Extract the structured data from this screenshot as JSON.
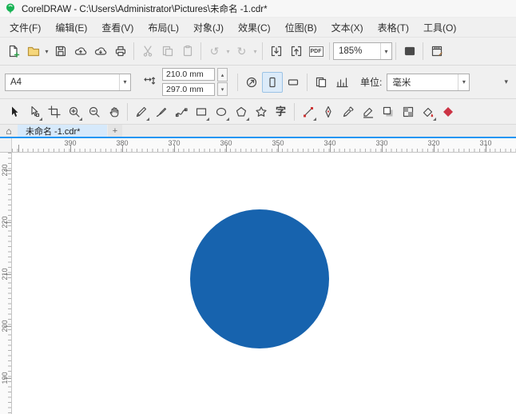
{
  "window": {
    "title": "CorelDRAW - C:\\Users\\Administrator\\Pictures\\未命名 -1.cdr*"
  },
  "menu": {
    "items": [
      "文件(F)",
      "编辑(E)",
      "查看(V)",
      "布局(L)",
      "对象(J)",
      "效果(C)",
      "位图(B)",
      "文本(X)",
      "表格(T)",
      "工具(O)"
    ]
  },
  "toolbar": {
    "zoom_value": "185%",
    "pdf_label": "PDF"
  },
  "property_bar": {
    "page_size": "A4",
    "width_value": "210.0 mm",
    "height_value": "297.0 mm",
    "units_label": "单位:",
    "units_value": "毫米"
  },
  "toolbox": {
    "text_tool_glyph": "字"
  },
  "tabs": {
    "home_glyph": "⌂",
    "active_label": "未命名 -1.cdr*",
    "new_tab_glyph": "+"
  },
  "rulers": {
    "horizontal": [
      "390",
      "380",
      "370",
      "360",
      "350",
      "340",
      "330",
      "320",
      "310"
    ],
    "vertical": [
      "230",
      "220",
      "210",
      "200",
      "190"
    ]
  },
  "canvas": {
    "circle_color": "#1763ae"
  },
  "colors": {
    "accent_blue": "#2196f3",
    "tab_active_bg": "#d6e9fb"
  },
  "icons": {
    "dropdown": "▾",
    "spin_up": "▴",
    "spin_down": "▾",
    "undo": "↺",
    "redo": "↻"
  }
}
